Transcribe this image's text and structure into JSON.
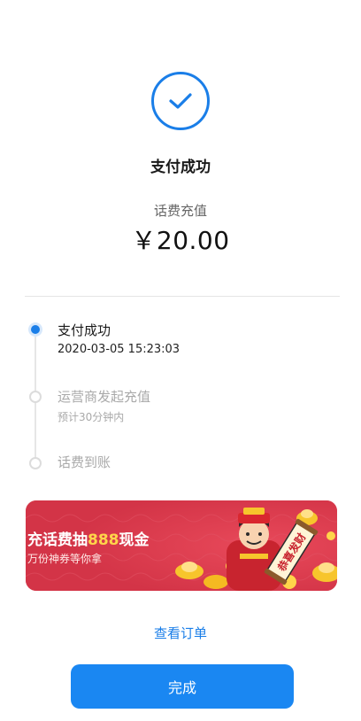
{
  "status": {
    "title": "支付成功",
    "order_type": "话费充值",
    "amount": "￥20.00"
  },
  "timeline": [
    {
      "title": "支付成功",
      "subtitle": "2020-03-05 15:23:03",
      "state": "done"
    },
    {
      "title": "运营商发起充值",
      "subtitle": "预计30分钟内",
      "state": "pending"
    },
    {
      "title": "话费到账",
      "subtitle": "",
      "state": "pending"
    }
  ],
  "banner": {
    "title_prefix": "充话费抽",
    "title_highlight": "888",
    "title_suffix": "现金",
    "subtitle": "万份神券等你拿",
    "scroll_text": "恭喜发财"
  },
  "actions": {
    "view_order_label": "查看订单",
    "done_label": "完成"
  },
  "colors": {
    "accent": "#1a7ee8",
    "banner_bg": "#d8394b",
    "highlight": "#ffd54a"
  }
}
